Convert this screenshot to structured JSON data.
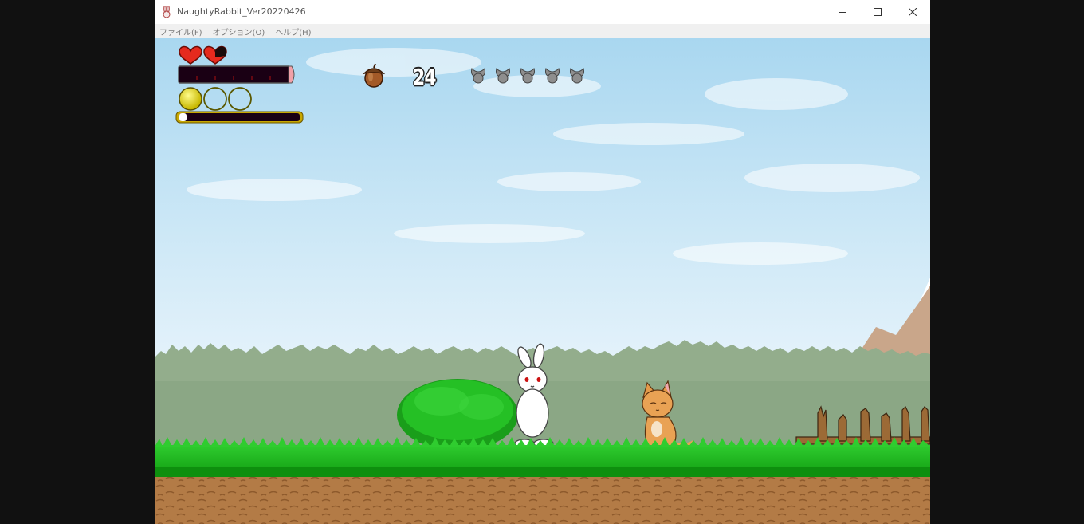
{
  "window": {
    "title": "NaughtyRabbit_Ver20220426",
    "controls": [
      "minimize-icon",
      "maximize-icon",
      "close-icon"
    ]
  },
  "menu": [
    {
      "label": "ファイル(F)"
    },
    {
      "label": "オプション(O)"
    },
    {
      "label": "ヘルプ(H)"
    }
  ],
  "hud": {
    "hearts": [
      {
        "state": "full"
      },
      {
        "state": "partial"
      }
    ],
    "health_bar_fill": 0.0,
    "orbs": [
      {
        "state": "filled"
      },
      {
        "state": "empty"
      },
      {
        "state": "empty"
      }
    ],
    "stamina_bar_fill": 0.05,
    "acorn_count": "24",
    "rabbit_lives_total": 5,
    "rabbit_lives_icon": "rabbit-head-icon"
  },
  "colors": {
    "heart": "#e52a1e",
    "orb": "#e8e000",
    "health_cap": "#f0a0a8",
    "bar_dark": "#1a0014",
    "sky_top": "#a8d8f0",
    "grass": "#1db31d",
    "dirt": "#b07a45"
  }
}
